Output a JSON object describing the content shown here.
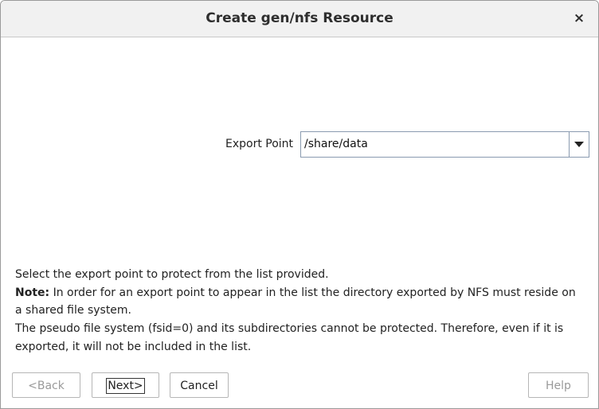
{
  "window": {
    "title": "Create gen/nfs Resource",
    "close_glyph": "×"
  },
  "form": {
    "export_point_label": "Export Point",
    "export_point_value": "/share/data"
  },
  "description": {
    "line1": "Select the export point to protect from the list provided.",
    "note_lead": "Note:",
    "note_text": " In order for an export point to appear in the list the directory exported by NFS must reside on a shared file system.",
    "line3": "The pseudo file system (fsid=0) and its subdirectories cannot be protected. Therefore, even if it is exported, it will not be included in the list."
  },
  "buttons": {
    "back": "<Back",
    "next": "Next>",
    "cancel": "Cancel",
    "help": "Help"
  },
  "icons": {
    "close": "close-icon",
    "dropdown": "chevron-down-icon"
  }
}
